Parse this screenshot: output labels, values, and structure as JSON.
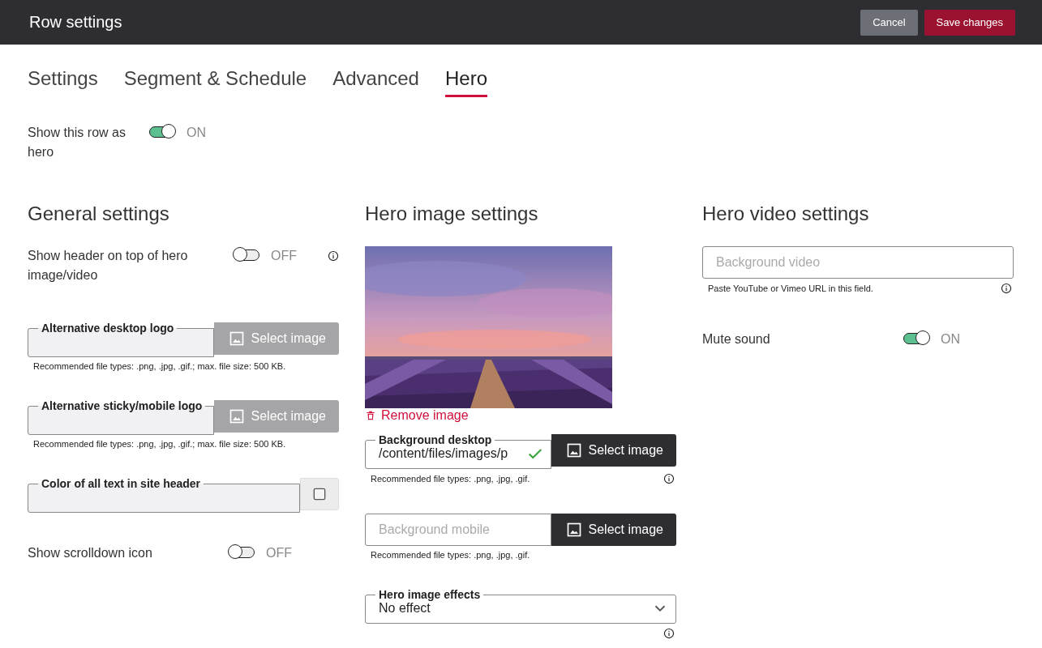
{
  "header": {
    "title": "Row settings",
    "buttons": [
      {
        "label": "Cancel",
        "kind": "secondary"
      },
      {
        "label": "Save changes",
        "kind": "primary"
      }
    ]
  },
  "tabs": [
    {
      "label": "Settings",
      "selected": false
    },
    {
      "label": "Segment & Schedule",
      "selected": false
    },
    {
      "label": "Advanced",
      "selected": false
    },
    {
      "label": "Hero",
      "selected": true
    }
  ],
  "hero_toggle": {
    "label": "Show this row as hero",
    "on": true,
    "state_text": "ON",
    "info": false
  },
  "general": {
    "heading": "General settings",
    "items": [
      {
        "kind": "toggle",
        "label": "Show header on top of hero image/video",
        "on": false,
        "state_text": "OFF",
        "info": true
      },
      {
        "kind": "file",
        "label": "Alternative desktop logo",
        "button": "Select image",
        "hint": "Recommended file types: .png, .jpg, .gif.; max. file size: 500 KB.",
        "disabled": true
      },
      {
        "kind": "file",
        "label": "Alternative sticky/mobile logo",
        "button": "Select image",
        "hint": "Recommended file types: .png, .jpg, .gif.; max. file size: 500 KB.",
        "disabled": true
      },
      {
        "kind": "color",
        "label": "Color of all text in site header"
      },
      {
        "kind": "toggle",
        "label": "Show scrolldown icon",
        "on": false,
        "state_text": "OFF",
        "info": false
      }
    ]
  },
  "image": {
    "heading": "Hero image settings",
    "items": [
      {
        "kind": "picture"
      },
      {
        "kind": "remove",
        "label": "Remove image"
      },
      {
        "kind": "file",
        "label": "Background desktop",
        "value": "/content/files/images/p",
        "valid": true,
        "button": "Select image",
        "hint": "Recommended file types: .png, .jpg, .gif.",
        "info": true,
        "disabled": false
      },
      {
        "kind": "file",
        "placeholder": "Background mobile",
        "button": "Select image",
        "hint": "Recommended file types: .png, .jpg, .gif.",
        "disabled": false
      },
      {
        "kind": "select",
        "label": "Hero image effects",
        "value": "No effect",
        "info": true
      }
    ]
  },
  "video": {
    "heading": "Hero video settings",
    "items": [
      {
        "kind": "text",
        "placeholder": "Background video",
        "hint": "Paste YouTube or Vimeo URL in this field.",
        "info": true
      },
      {
        "kind": "toggle",
        "label": "Mute sound",
        "on": true,
        "state_text": "ON",
        "info": false
      }
    ]
  }
}
